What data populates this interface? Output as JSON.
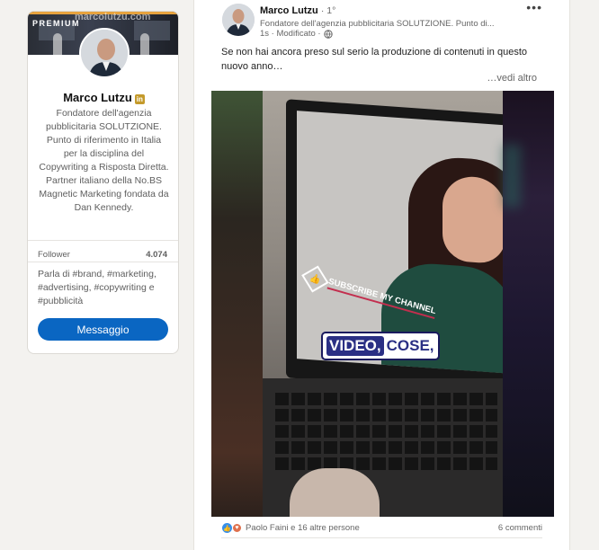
{
  "profile": {
    "premium_label": "PREMIUM",
    "banner_site": "marcolutzu.com",
    "name": "Marco Lutzu",
    "linkedin_badge": "in",
    "bio": "Fondatore dell'agenzia pubblicitaria SOLUTZIONE. Punto di riferimento in Italia per la disciplina del Copywriting a Risposta Diretta. Partner italiano della No.BS Magnetic Marketing fondata da Dan Kennedy.",
    "follower_label": "Follower",
    "follower_count": "4.074",
    "hashtags": "Parla di #brand, #marketing, #advertising, #copywriting e #pubblicità",
    "message_button": "Messaggio"
  },
  "post": {
    "author_name": "Marco Lutzu",
    "author_degree": "· 1°",
    "author_headline": "Fondatore dell'agenzia pubblicitaria SOLUTZIONE. Punto di...",
    "meta": "1s · Modificato ·",
    "more_icon": "•••",
    "text": "Se non hai ancora preso sul serio la produzione di contenuti in questo nuovo anno…",
    "see_more": "…vedi altro",
    "video": {
      "subscribe_text": "SUBSCRIBE MY CHANNEL",
      "caption_word1": "VIDEO,",
      "caption_word2": "COSE,"
    },
    "reactions_text": "Paolo Faini e 16 altre persone",
    "comments_text": "6 commenti"
  },
  "colors": {
    "primary_blue": "#0a66c2",
    "premium_gold": "#c49a2b",
    "like_blue": "#378fe9",
    "love_red": "#df704d"
  },
  "icons": [
    "globe-icon",
    "more-icon",
    "like-reaction-icon",
    "love-reaction-icon",
    "linkedin-badge-icon"
  ]
}
